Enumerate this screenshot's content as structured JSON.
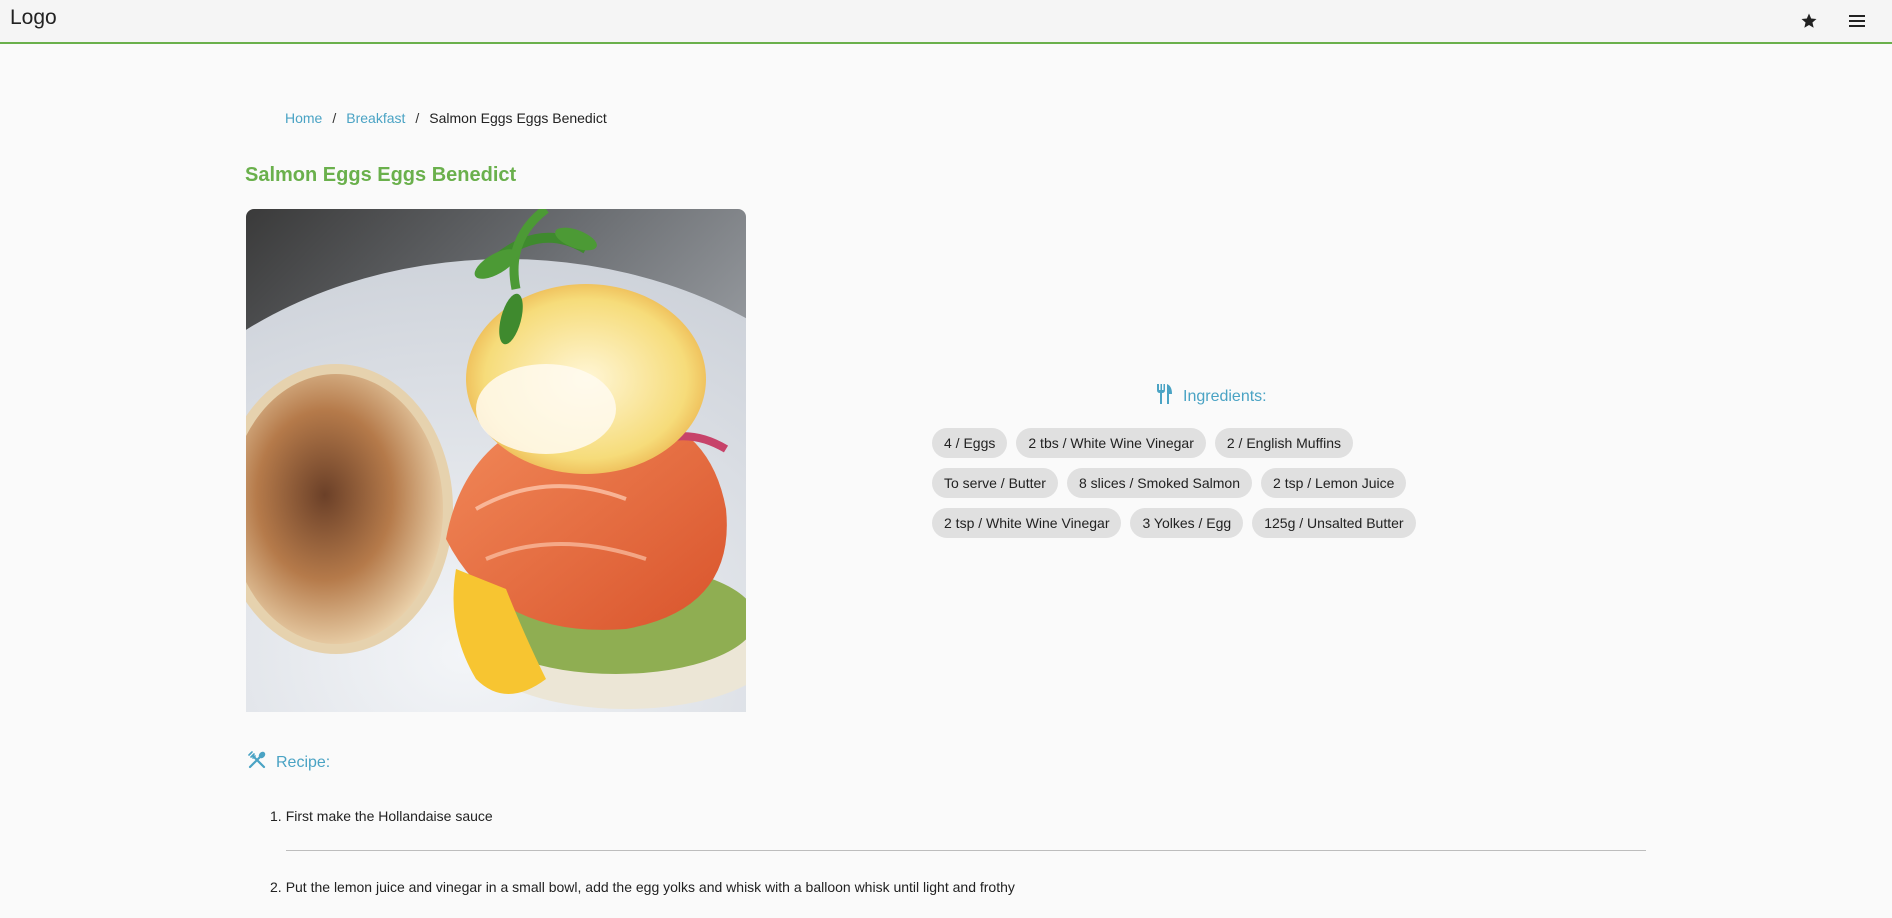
{
  "header": {
    "logo": "Logo",
    "icons": [
      "star-icon",
      "menu-icon"
    ]
  },
  "breadcrumb": {
    "home": "Home",
    "separator": "/",
    "category": "Breakfast",
    "current": "Salmon Eggs Eggs Benedict"
  },
  "recipe": {
    "title": "Salmon Eggs Eggs Benedict",
    "ingredients_heading": "Ingredients:",
    "ingredients": [
      "4 / Eggs",
      "2 tbs / White Wine Vinegar",
      "2 / English Muffins",
      "To serve / Butter",
      "8 slices / Smoked Salmon",
      "2 tsp / Lemon Juice",
      "2 tsp / White Wine Vinegar",
      "3 Yolkes / Egg",
      "125g / Unsalted Butter"
    ],
    "recipe_heading": "Recipe:",
    "steps": [
      {
        "num": "1.",
        "text": "First make the Hollandaise sauce"
      },
      {
        "num": "2.",
        "text": "Put the lemon juice and vinegar in a small bowl, add the egg yolks and whisk with a balloon whisk until light and frothy"
      }
    ]
  },
  "colors": {
    "accent_green": "#6ab04c",
    "link_blue": "#4aa3c4",
    "chip_bg": "#e0e0e0"
  }
}
